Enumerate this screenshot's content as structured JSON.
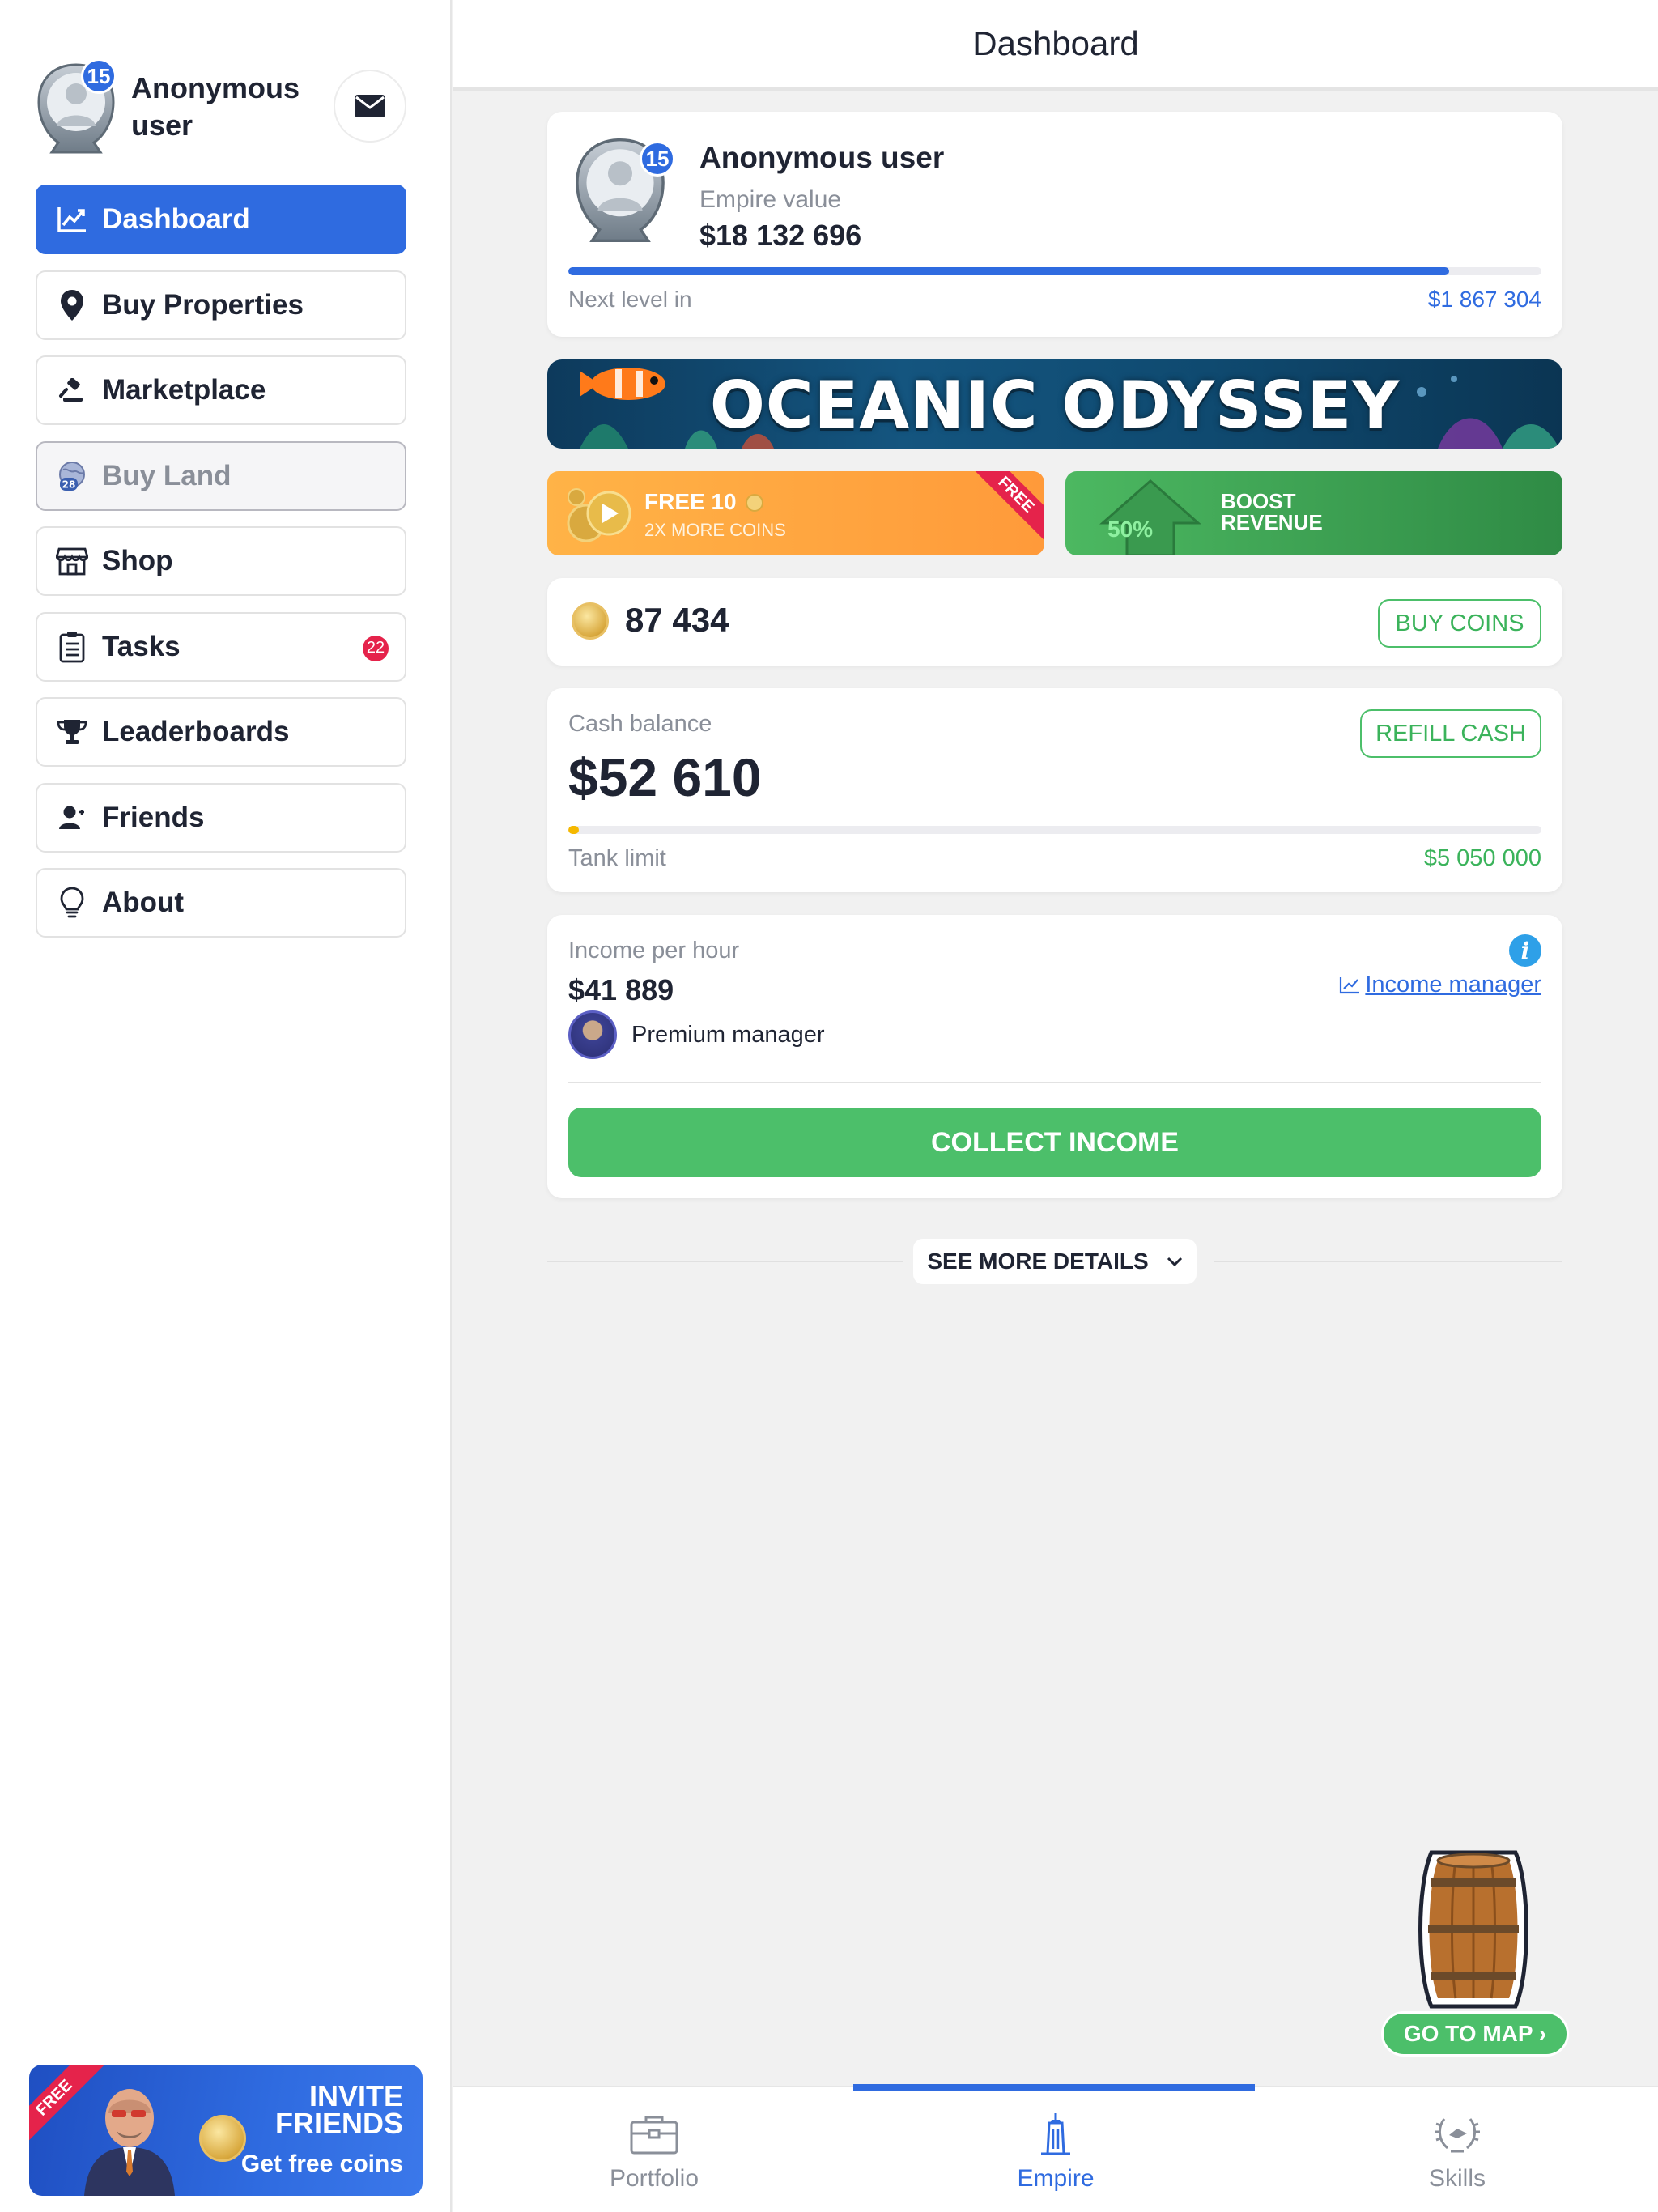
{
  "sidebar": {
    "user": {
      "level": "15",
      "name": "Anonymous user"
    },
    "nav": [
      {
        "label": "Dashboard",
        "icon": "chart-icon"
      },
      {
        "label": "Buy Properties",
        "icon": "map-pin-icon"
      },
      {
        "label": "Marketplace",
        "icon": "gavel-icon"
      },
      {
        "label": "Buy Land",
        "icon": "globe-icon",
        "badge": "28"
      },
      {
        "label": "Shop",
        "icon": "store-icon"
      },
      {
        "label": "Tasks",
        "icon": "clipboard-icon",
        "badge": "22"
      },
      {
        "label": "Leaderboards",
        "icon": "trophy-icon"
      },
      {
        "label": "Friends",
        "icon": "user-icon"
      },
      {
        "label": "About",
        "icon": "lightbulb-icon"
      }
    ],
    "invite": {
      "ribbon": "FREE",
      "title": "INVITE FRIENDS",
      "subtitle": "Get free coins"
    }
  },
  "header": {
    "title": "Dashboard"
  },
  "profile_card": {
    "level": "15",
    "name": "Anonymous user",
    "empire_label": "Empire value",
    "empire_value": "$18 132 696",
    "progress": 0.905,
    "next_label": "Next level in",
    "next_value": "$1 867 304"
  },
  "banner": {
    "title": "OCEANIC ODYSSEY"
  },
  "promo_free": {
    "title": "FREE 10",
    "subtitle": "2X MORE COINS",
    "ribbon": "FREE"
  },
  "promo_boost": {
    "percent": "50%",
    "title": "BOOST REVENUE"
  },
  "coins": {
    "value": "87 434",
    "button": "BUY COINS"
  },
  "cash": {
    "label": "Cash balance",
    "value": "$52 610",
    "button": "REFILL CASH",
    "fill": 0.0104,
    "tank_label": "Tank limit",
    "tank_value": "$5 050 000"
  },
  "income": {
    "label": "Income per hour",
    "value": "$41 889",
    "manager_link": "Income manager",
    "manager_label": "Premium manager",
    "button": "COLLECT INCOME"
  },
  "details": {
    "label": "SEE MORE DETAILS"
  },
  "map": {
    "button": "GO TO MAP ›"
  },
  "tabs": [
    {
      "label": "Portfolio",
      "icon": "briefcase-icon"
    },
    {
      "label": "Empire",
      "icon": "building-icon"
    },
    {
      "label": "Skills",
      "icon": "laurel-icon"
    }
  ],
  "colors": {
    "primary": "#2f6be0",
    "success": "#4cbf6a",
    "danger": "#e5234b",
    "warning": "#f5b800"
  }
}
